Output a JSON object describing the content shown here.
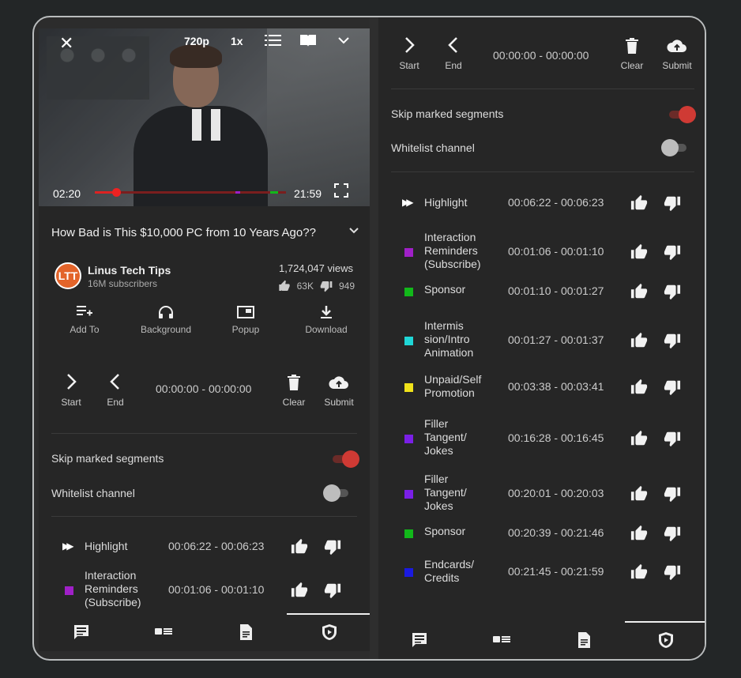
{
  "player": {
    "quality": "720p",
    "speed": "1x",
    "time_current": "02:20",
    "time_total": "21:59"
  },
  "video": {
    "title": "How Bad is This $10,000 PC from 10 Years Ago??",
    "channel": "Linus Tech Tips",
    "subscribers": "16M subscribers",
    "views": "1,724,047 views",
    "likes": "63K",
    "dislikes": "949"
  },
  "actions": [
    {
      "label": "Add To",
      "icon": "playlist-add-icon"
    },
    {
      "label": "Background",
      "icon": "headphones-icon"
    },
    {
      "label": "Popup",
      "icon": "popup-icon"
    },
    {
      "label": "Download",
      "icon": "download-icon"
    }
  ],
  "sponsorblock": {
    "start_label": "Start",
    "end_label": "End",
    "time_range": "00:00:00 - 00:00:00",
    "clear_label": "Clear",
    "submit_label": "Submit",
    "skip_label": "Skip marked segments",
    "skip_on": true,
    "whitelist_label": "Whitelist channel",
    "whitelist_on": false
  },
  "segments": [
    {
      "category": "Highlight",
      "time": "00:06:22 - 00:06:23",
      "color": "highlight"
    },
    {
      "category": "Interaction Reminders (Subscribe)",
      "lines": [
        "Interaction",
        "Reminders",
        "(Subscribe)"
      ],
      "time": "00:01:06 - 00:01:10",
      "color": "#a020c8"
    },
    {
      "category": "Sponsor",
      "lines": [
        "Sponsor"
      ],
      "time": "00:01:10 - 00:01:27",
      "color": "#12b81a"
    },
    {
      "category": "Intermission/Intro Animation",
      "lines": [
        "Intermis",
        "sion/Intro",
        "Animation"
      ],
      "time": "00:01:27 - 00:01:37",
      "color": "#1fd6d6"
    },
    {
      "category": "Unpaid/Self Promotion",
      "lines": [
        "Unpaid/Self",
        "Promotion"
      ],
      "time": "00:03:38 - 00:03:41",
      "color": "#f0e21a"
    },
    {
      "category": "Filler Tangent/ Jokes",
      "lines": [
        "Filler",
        "Tangent/",
        "Jokes"
      ],
      "time": "00:16:28 - 00:16:45",
      "color": "#7a1fe6"
    },
    {
      "category": "Filler Tangent/ Jokes",
      "lines": [
        "Filler",
        "Tangent/",
        "Jokes"
      ],
      "time": "00:20:01 - 00:20:03",
      "color": "#7a1fe6"
    },
    {
      "category": "Sponsor",
      "lines": [
        "Sponsor"
      ],
      "time": "00:20:39 - 00:21:46",
      "color": "#12b81a"
    },
    {
      "category": "Endcards/ Credits",
      "lines": [
        "Endcards/",
        "Credits"
      ],
      "time": "00:21:45 - 00:21:59",
      "color": "#1a1ae0"
    }
  ],
  "nav": [
    {
      "icon": "comments-icon"
    },
    {
      "icon": "related-videos-icon"
    },
    {
      "icon": "description-icon"
    },
    {
      "icon": "sponsorblock-icon"
    }
  ]
}
